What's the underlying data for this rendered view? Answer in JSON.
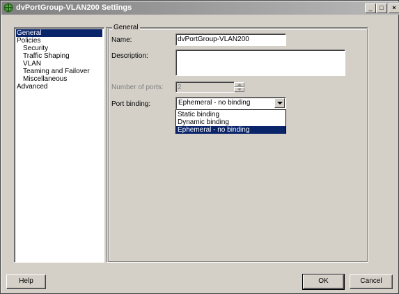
{
  "window": {
    "title": "dvPortGroup-VLAN200 Settings",
    "controls": {
      "minimize": "_",
      "maximize": "□",
      "close": "×"
    }
  },
  "nav": {
    "items": [
      {
        "label": "General",
        "selected": true
      },
      {
        "label": "Policies"
      },
      {
        "label": "Security"
      },
      {
        "label": "Traffic Shaping"
      },
      {
        "label": "VLAN"
      },
      {
        "label": "Teaming and Failover"
      },
      {
        "label": "Miscellaneous"
      },
      {
        "label": "Advanced"
      }
    ]
  },
  "general": {
    "group_title": "General",
    "name_label": "Name:",
    "name_value": "dvPortGroup-VLAN200",
    "description_label": "Description:",
    "description_value": "",
    "ports_label": "Number of ports:",
    "ports_value": "2",
    "binding_label": "Port binding:",
    "binding_value": "Ephemeral - no binding",
    "binding_options": [
      "Static binding",
      "Dynamic binding",
      "Ephemeral - no binding"
    ]
  },
  "buttons": {
    "help": "Help",
    "ok": "OK",
    "cancel": "Cancel"
  },
  "colors": {
    "selection": "#0a246a",
    "dialog_bg": "#d4d0c8"
  }
}
